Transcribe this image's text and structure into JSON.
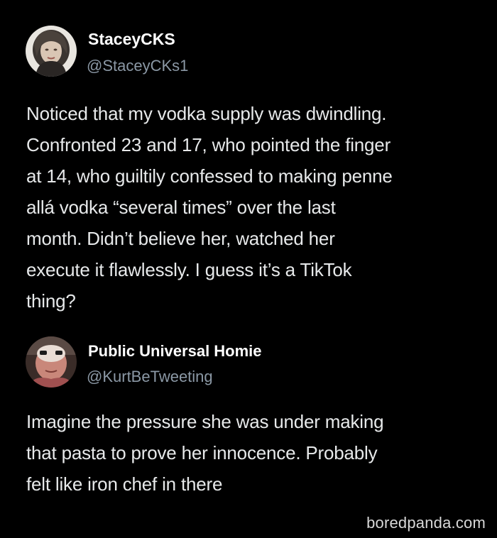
{
  "tweets": [
    {
      "display_name": "StaceyCKS",
      "handle": "@StaceyCKs1",
      "avatar_icon": "profile-photo",
      "lines": [
        "Noticed that my vodka supply was dwindling.",
        "Confronted 23 and 17, who pointed the finger",
        "at 14, who guiltily confessed to making penne",
        "allá vodka “several times” over the last",
        "month. Didn’t believe her, watched her",
        "execute it flawlessly. I guess it’s a TikTok",
        "thing?"
      ]
    },
    {
      "display_name": "Public Universal Homie",
      "handle": "@KurtBeTweeting",
      "avatar_icon": "profile-photo",
      "lines": [
        "Imagine the pressure she was under making",
        "that pasta to prove her innocence. Probably",
        "felt like iron chef in there"
      ]
    }
  ],
  "watermark": "boredpanda.com",
  "colors": {
    "background": "#000000",
    "name": "#ffffff",
    "text": "#e7e9ea",
    "handle": "#8b98a5"
  }
}
